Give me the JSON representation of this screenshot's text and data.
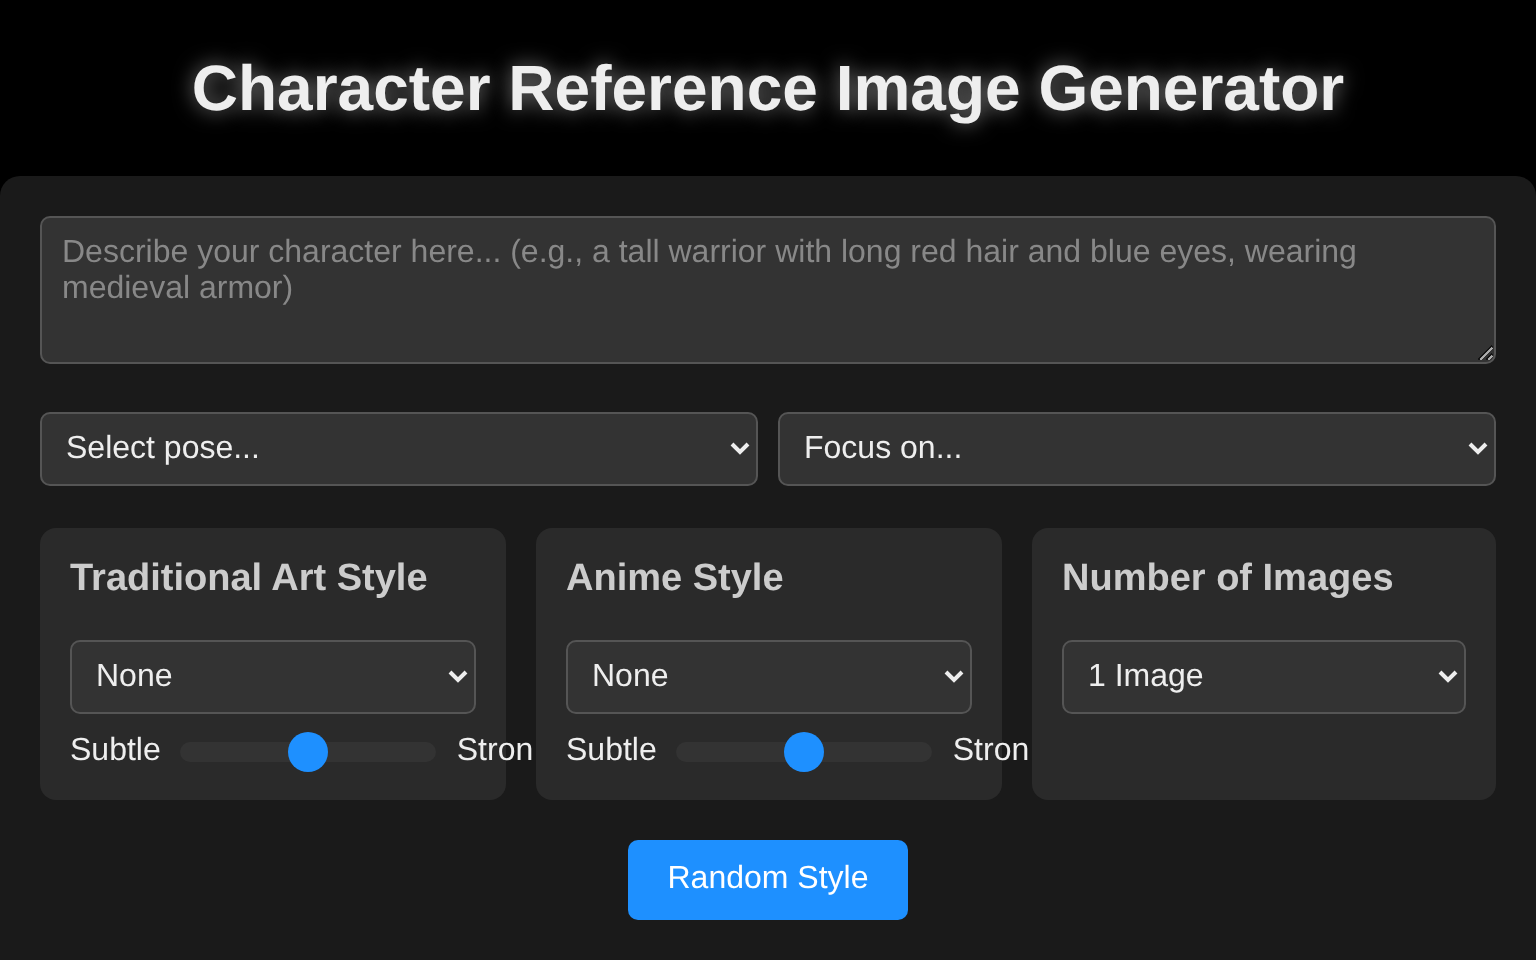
{
  "title": "Character Reference Image Generator",
  "description": {
    "placeholder": "Describe your character here... (e.g., a tall warrior with long red hair and blue eyes, wearing medieval armor)"
  },
  "pose_select": {
    "value": "Select pose..."
  },
  "focus_select": {
    "value": "Focus on..."
  },
  "cards": [
    {
      "kind": "style",
      "title": "Traditional Art Style",
      "value": "None",
      "slider": {
        "min_label": "Subtle",
        "max_label": "Stron",
        "level": 0.5
      }
    },
    {
      "kind": "style",
      "title": "Anime Style",
      "value": "None",
      "slider": {
        "min_label": "Subtle",
        "max_label": "Stron",
        "level": 0.5
      }
    },
    {
      "kind": "count",
      "title": "Number of Images",
      "value": "1 Image"
    }
  ],
  "random_button": "Random Style"
}
